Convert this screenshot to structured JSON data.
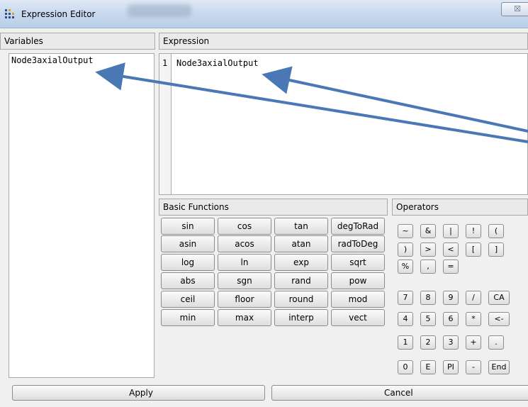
{
  "window": {
    "title": "Expression Editor",
    "close_glyph": "☒"
  },
  "variables": {
    "header": "Variables",
    "items": [
      "Node3axialOutput"
    ]
  },
  "expression": {
    "header": "Expression",
    "line_number": "1",
    "text": "Node3axialOutput"
  },
  "basic_functions": {
    "header": "Basic Functions",
    "buttons": [
      "sin",
      "cos",
      "tan",
      "degToRad",
      "asin",
      "acos",
      "atan",
      "radToDeg",
      "log",
      "ln",
      "exp",
      "sqrt",
      "abs",
      "sgn",
      "rand",
      "pow",
      "ceil",
      "floor",
      "round",
      "mod",
      "min",
      "max",
      "interp",
      "vect"
    ]
  },
  "operators": {
    "header": "Operators",
    "buttons": [
      "~",
      "&",
      "|",
      "!",
      "(",
      ")",
      ">",
      "<",
      "[",
      "]",
      "%",
      ",",
      "=",
      "7",
      "8",
      "9",
      "/",
      "CA",
      "4",
      "5",
      "6",
      "*",
      "<-",
      "1",
      "2",
      "3",
      "+",
      ".",
      "0",
      "E",
      "PI",
      "-",
      "End"
    ]
  },
  "footer": {
    "apply_label": "Apply",
    "cancel_label": "Cancel"
  },
  "colors": {
    "arrow": "#4a78b5",
    "title_bar": "#c9daee"
  },
  "icons": {
    "app": "grid-dots-icon",
    "close": "close-icon"
  }
}
